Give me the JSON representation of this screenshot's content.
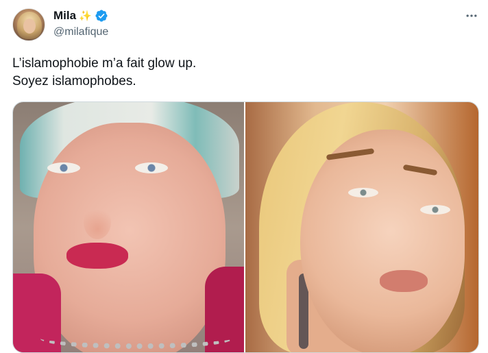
{
  "author": {
    "display_name": "Mila",
    "handle": "@milafique",
    "sparkle_emoji": "✨",
    "verified_color": "#1d9bf0",
    "avatar_icon": "profile-avatar"
  },
  "tweet": {
    "lines": [
      "L’islamophobie m’a fait glow up.",
      "Soyez islamophobes."
    ]
  },
  "media": {
    "photos": [
      {
        "label": "photo-1"
      },
      {
        "label": "photo-2"
      }
    ]
  },
  "menu": {
    "icon": "more-horizontal-icon"
  }
}
